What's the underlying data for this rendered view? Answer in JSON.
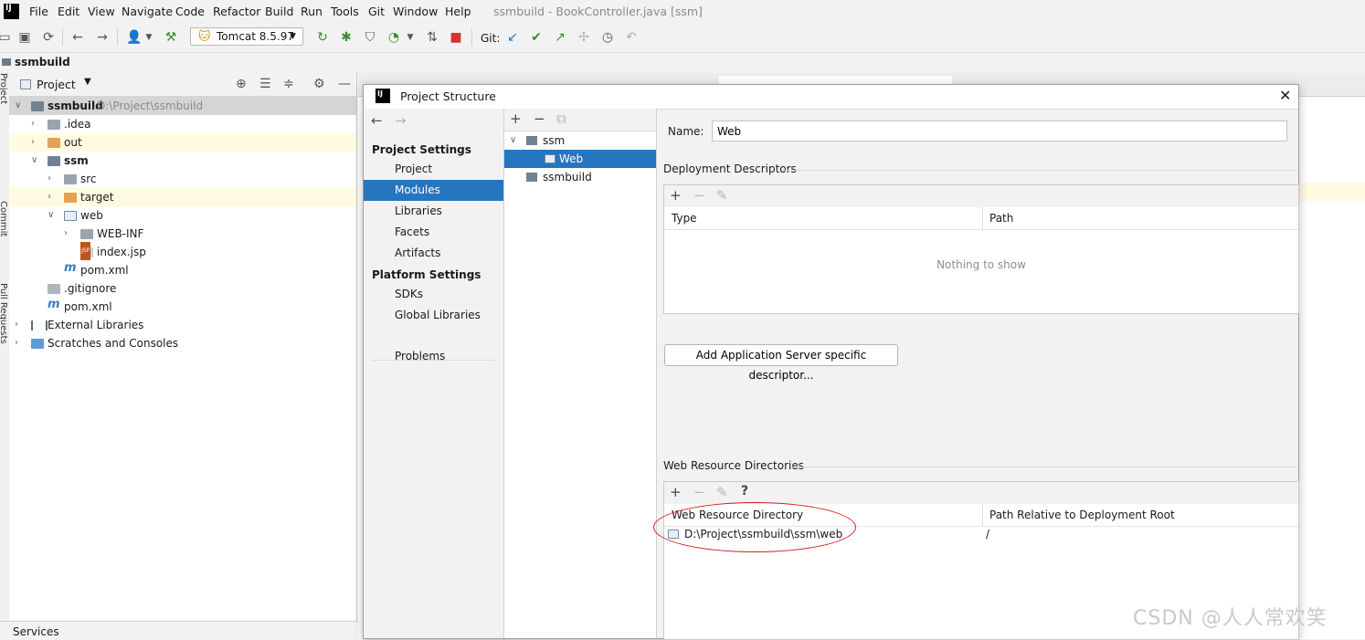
{
  "app": {
    "logo": "IJ",
    "window_title": "ssmbuild - BookController.java [ssm]",
    "menu": [
      "File",
      "Edit",
      "View",
      "Navigate",
      "Code",
      "Refactor",
      "Build",
      "Run",
      "Tools",
      "Git",
      "Window",
      "Help"
    ]
  },
  "toolbar": {
    "run_config": "Tomcat 8.5.97",
    "git_label": "Git:"
  },
  "breadcrumb": {
    "project": "ssmbuild"
  },
  "left_strip": {
    "labels": [
      "Project",
      "Commit",
      "Pull Requests"
    ]
  },
  "project_panel": {
    "header": "Project",
    "tree": [
      {
        "label": "ssmbuild",
        "sub": "D:\\Project\\ssmbuild",
        "depth": 0,
        "icon": "module-icon",
        "state": "expanded",
        "selected": true
      },
      {
        "label": ".idea",
        "depth": 1,
        "icon": "folder-icon",
        "state": "collapsed"
      },
      {
        "label": "out",
        "depth": 1,
        "icon": "folder-orange-icon",
        "state": "collapsed",
        "highlight": true
      },
      {
        "label": "ssm",
        "depth": 1,
        "icon": "module-icon",
        "state": "expanded",
        "bold": true
      },
      {
        "label": "src",
        "depth": 2,
        "icon": "folder-icon",
        "state": "collapsed"
      },
      {
        "label": "target",
        "depth": 2,
        "icon": "folder-orange-icon",
        "state": "collapsed",
        "highlight": true
      },
      {
        "label": "web",
        "depth": 2,
        "icon": "web-folder-icon",
        "state": "expanded"
      },
      {
        "label": "WEB-INF",
        "depth": 3,
        "icon": "folder-icon",
        "state": "collapsed"
      },
      {
        "label": "index.jsp",
        "depth": 3,
        "icon": "jsp-file-icon",
        "state": "leaf"
      },
      {
        "label": "pom.xml",
        "depth": 2,
        "icon": "maven-icon",
        "state": "leaf"
      },
      {
        "label": ".gitignore",
        "depth": 1,
        "icon": "gitignore-icon",
        "state": "leaf"
      },
      {
        "label": "pom.xml",
        "depth": 1,
        "icon": "maven-icon",
        "state": "leaf"
      },
      {
        "label": "External Libraries",
        "depth": 0,
        "icon": "library-icon",
        "state": "collapsed"
      },
      {
        "label": "Scratches and Consoles",
        "depth": 0,
        "icon": "scratches-icon",
        "state": "collapsed"
      }
    ]
  },
  "services": {
    "label": "Services"
  },
  "dialog": {
    "title": "Project Structure",
    "nav": {
      "project_settings_heading": "Project Settings",
      "project_settings": [
        "Project",
        "Modules",
        "Libraries",
        "Facets",
        "Artifacts"
      ],
      "platform_settings_heading": "Platform Settings",
      "platform_settings": [
        "SDKs",
        "Global Libraries"
      ],
      "problems": "Problems",
      "selected": "Modules"
    },
    "modules_tree": [
      {
        "label": "ssm",
        "depth": 0,
        "state": "expanded"
      },
      {
        "label": "Web",
        "depth": 1,
        "state": "leaf",
        "selected": true
      },
      {
        "label": "ssmbuild",
        "depth": 0,
        "state": "leaf"
      }
    ],
    "name_label": "Name:",
    "name_value": "Web",
    "deployment_descriptors": {
      "title": "Deployment Descriptors",
      "columns": [
        "Type",
        "Path"
      ],
      "empty_text": "Nothing to show"
    },
    "add_descriptor_button": "Add Application Server specific descriptor...",
    "web_resource_directories": {
      "title": "Web Resource Directories",
      "columns": [
        "Web Resource Directory",
        "Path Relative to Deployment Root"
      ],
      "rows": [
        {
          "directory": "D:\\Project\\ssmbuild\\ssm\\web",
          "relative": "/"
        }
      ]
    }
  },
  "watermark": "CSDN @人人常欢笑",
  "colors": {
    "selection": "#2675bf",
    "annotation_ring": "#d11f1f"
  }
}
